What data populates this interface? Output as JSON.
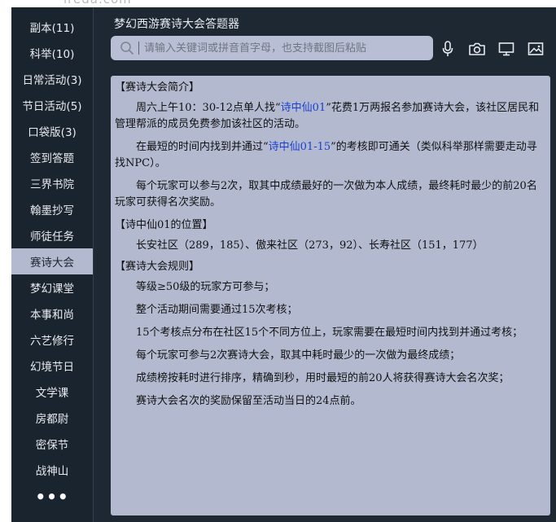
{
  "watermark": "ireda.com",
  "sidebar": {
    "items": [
      {
        "label": "副本(11)"
      },
      {
        "label": "科举(10)"
      },
      {
        "label": "日常活动(3)"
      },
      {
        "label": "节日活动(5)"
      },
      {
        "label": "口袋版(3)"
      },
      {
        "label": "签到答题"
      },
      {
        "label": "三界书院"
      },
      {
        "label": "翰墨抄写"
      },
      {
        "label": "师徒任务"
      },
      {
        "label": "赛诗大会"
      },
      {
        "label": "梦幻课堂"
      },
      {
        "label": "本事和尚"
      },
      {
        "label": "六艺修行"
      },
      {
        "label": "幻境节日"
      },
      {
        "label": "文学课"
      },
      {
        "label": "房都尉"
      },
      {
        "label": "密保节"
      },
      {
        "label": "战神山"
      }
    ],
    "active": "赛诗大会",
    "more": "•••"
  },
  "app_title": "梦幻西游赛诗大会答题器",
  "search": {
    "placeholder": "请输入关键词或拼音首字母，也支持截图后粘贴",
    "value": ""
  },
  "toolbar": {
    "icons": [
      "microphone-icon",
      "camera-icon",
      "monitor-icon",
      "image-icon"
    ]
  },
  "content": {
    "intro_heading": "【赛诗大会简介】",
    "intro_p1_a": "周六上午10：30-12点单人找“",
    "intro_p1_link": "诗中仙01",
    "intro_p1_b": "”花费1万两报名参加赛诗大会，该社区居民和管理帮派的成员免费参加该社区的活动。",
    "intro_p2_a": "在最短的时间内找到并通过“",
    "intro_p2_link": "诗中仙01-15",
    "intro_p2_b": "”的考核即可通关（类似科举那样需要走动寻找NPC）。",
    "intro_p3": "每个玩家可以参与2次，取其中成绩最好的一次做为本人成绩，最终耗时最少的前20名玩家可获得名次奖励。",
    "location_heading": "【诗中仙01的位置】",
    "location_p": "长安社区（289，185）、傲来社区（273，92）、长寿社区（151，177）",
    "rules_heading": "【赛诗大会规则】",
    "rules": [
      "等级≥50级的玩家方可参与；",
      "整个活动期间需要通过15次考核；",
      "15个考核点分布在社区15个不同方位上，玩家需要在最短时间内找到并通过考核；",
      "每个玩家可参与2次赛诗大会，取其中耗时最少的一次做为最终成绩；",
      "成绩榜按耗时进行排序，精确到秒，用时最短的前20人将获得赛诗大会名次奖；",
      "赛诗大会名次的奖励保留至活动当日的24点前。"
    ]
  },
  "colors": {
    "app_bg": "#1d2833",
    "sidebar_bg": "#1a242e",
    "panel_bg": "#b3bad0",
    "link": "#1a3fd0"
  }
}
